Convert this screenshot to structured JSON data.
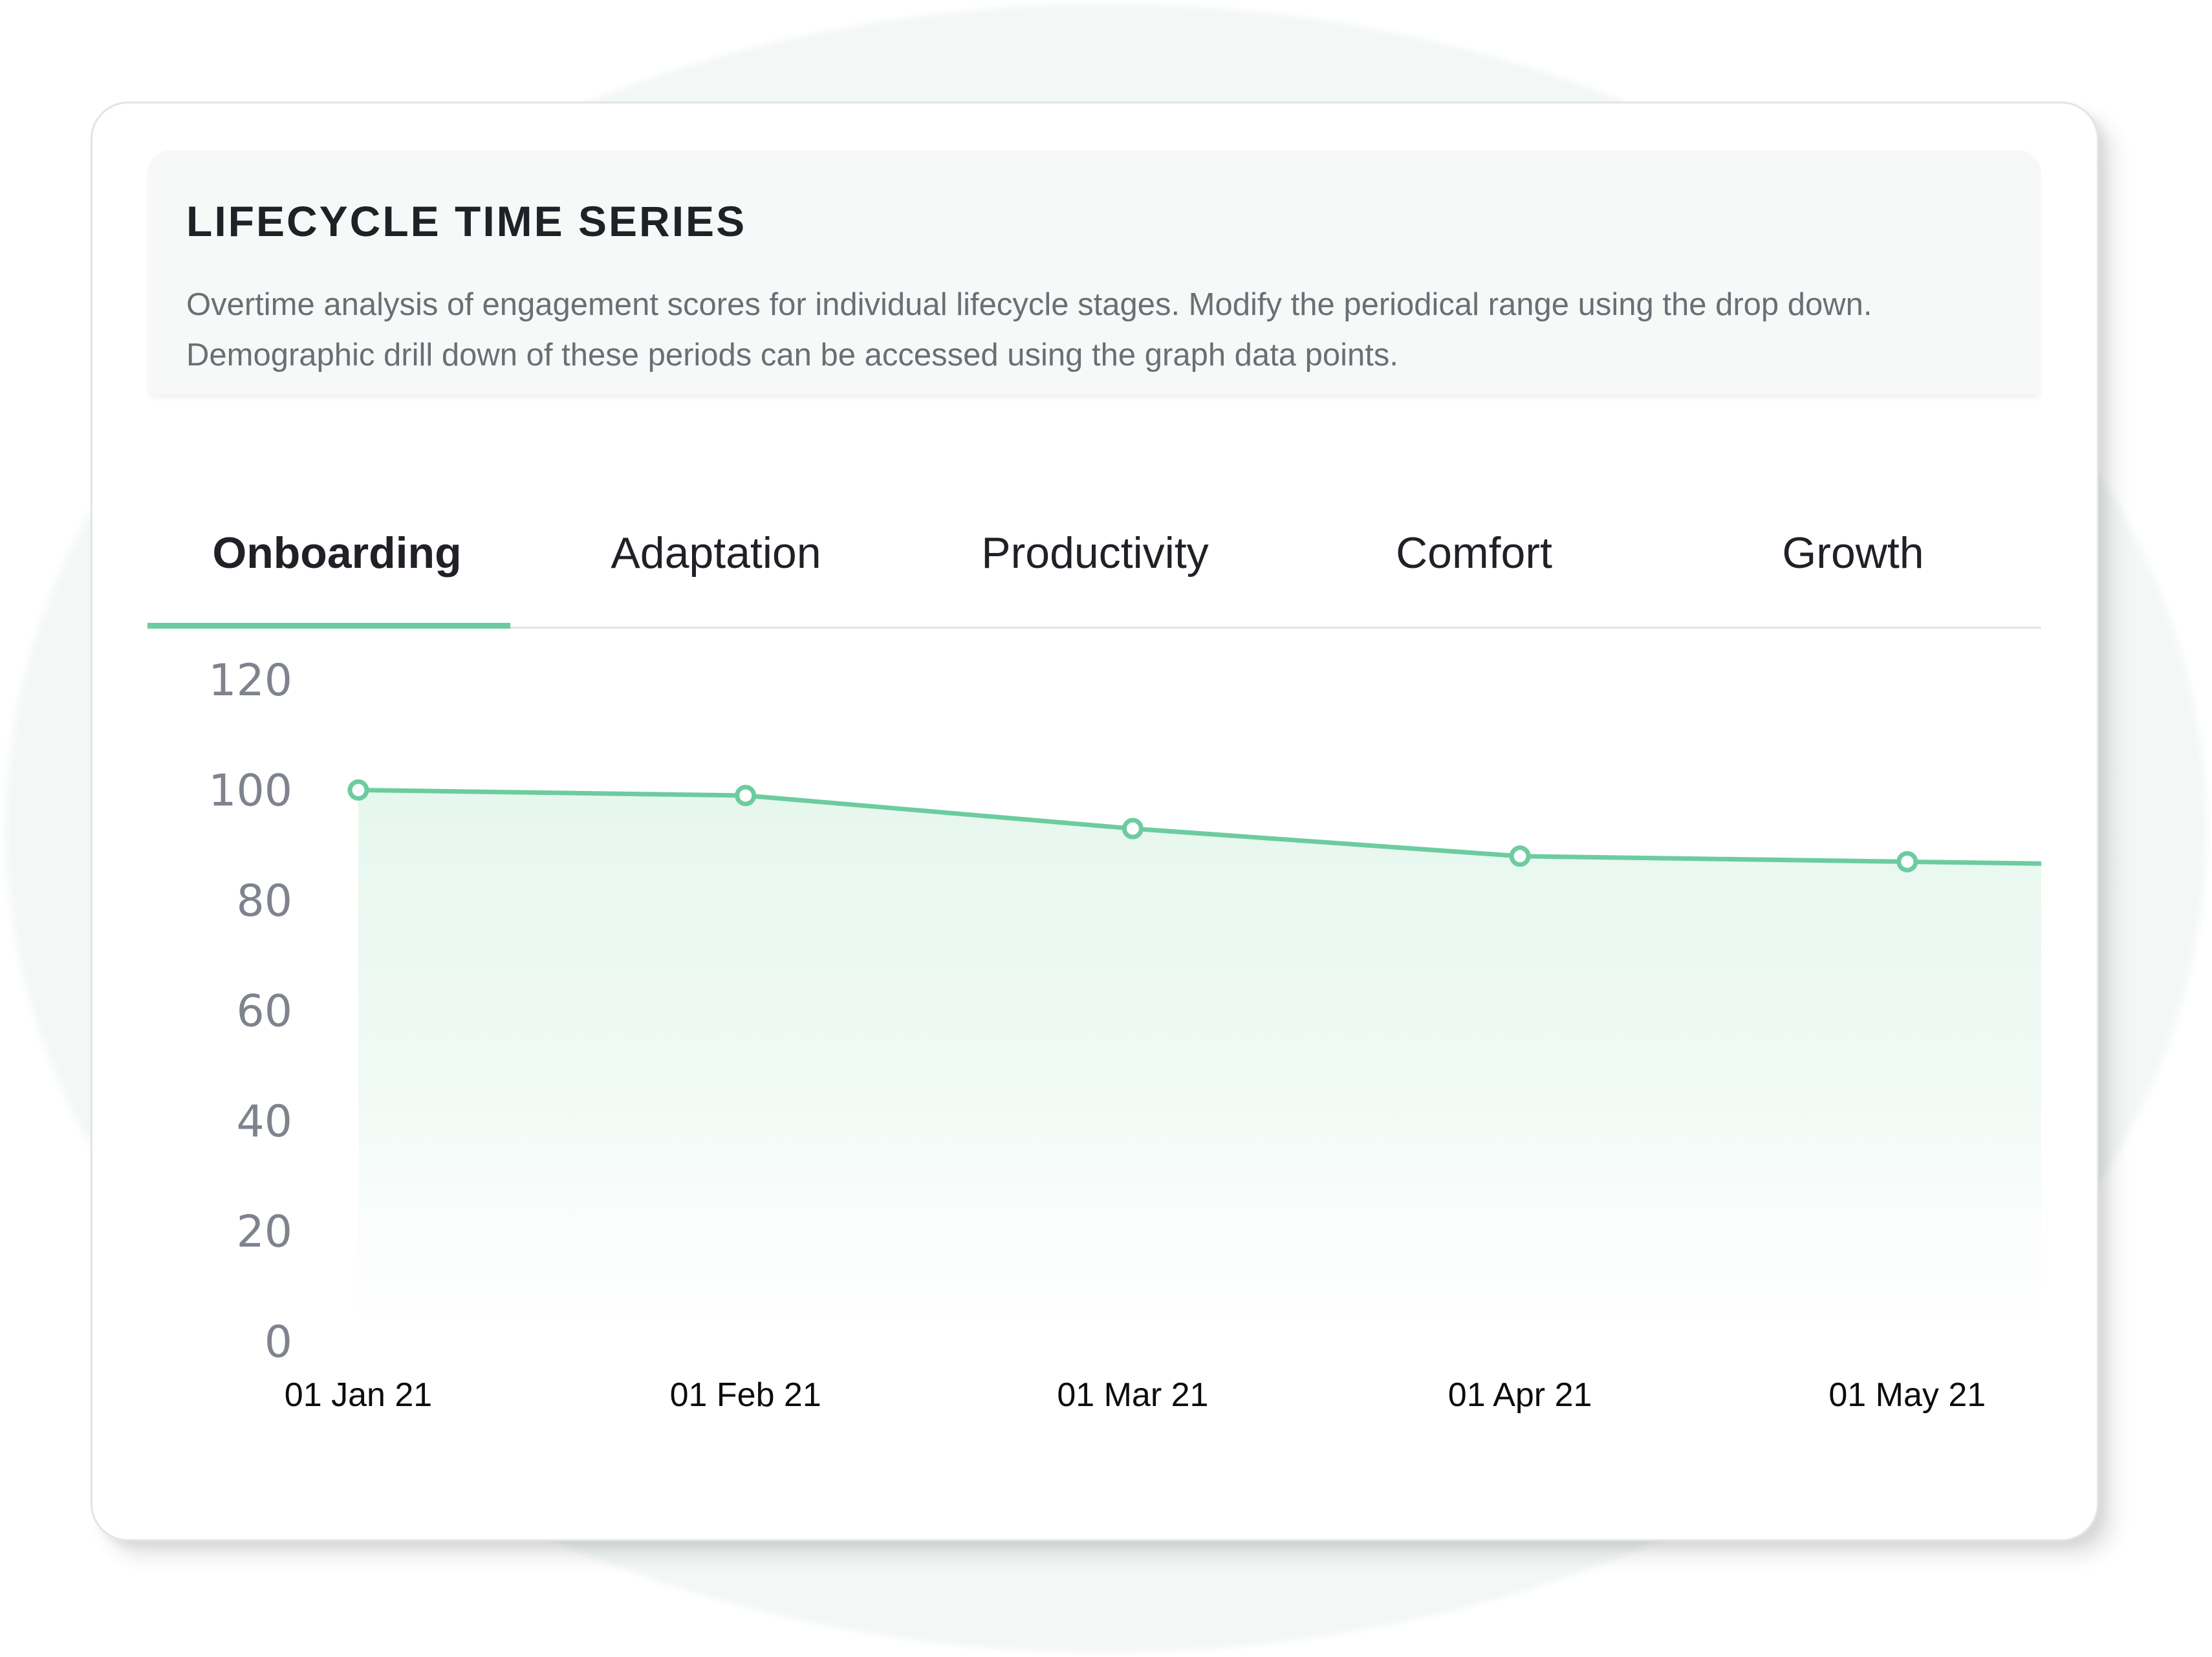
{
  "header": {
    "title": "LIFECYCLE TIME SERIES",
    "description_line1": "Overtime analysis of engagement scores for individual lifecycle stages. Modify the periodical range using the drop down.",
    "description_line2": "Demographic drill down of these periods can be accessed using the graph data points."
  },
  "tabs": [
    {
      "label": "Onboarding",
      "active": true
    },
    {
      "label": "Adaptation",
      "active": false
    },
    {
      "label": "Productivity",
      "active": false
    },
    {
      "label": "Comfort",
      "active": false
    },
    {
      "label": "Growth",
      "active": false
    }
  ],
  "colors": {
    "accent": "#6ccc9f",
    "fill_top": "#e8f8f0",
    "axis_label": "#7e838d",
    "text_dark": "#1f2126"
  },
  "chart_data": {
    "type": "area",
    "title": "",
    "xlabel": "",
    "ylabel": "",
    "categories": [
      "01 Jan 21",
      "01 Feb 21",
      "01 Mar 21",
      "01 Apr 21",
      "01 May 21"
    ],
    "series": [
      {
        "name": "Onboarding",
        "values": [
          100,
          99,
          93,
          88,
          87
        ]
      }
    ],
    "trailing_value": 86,
    "ylim": [
      0,
      120
    ],
    "yticks": [
      120,
      100,
      80,
      60,
      40,
      20,
      0
    ],
    "grid": false,
    "legend": "none",
    "markers": "hollow-circle"
  }
}
